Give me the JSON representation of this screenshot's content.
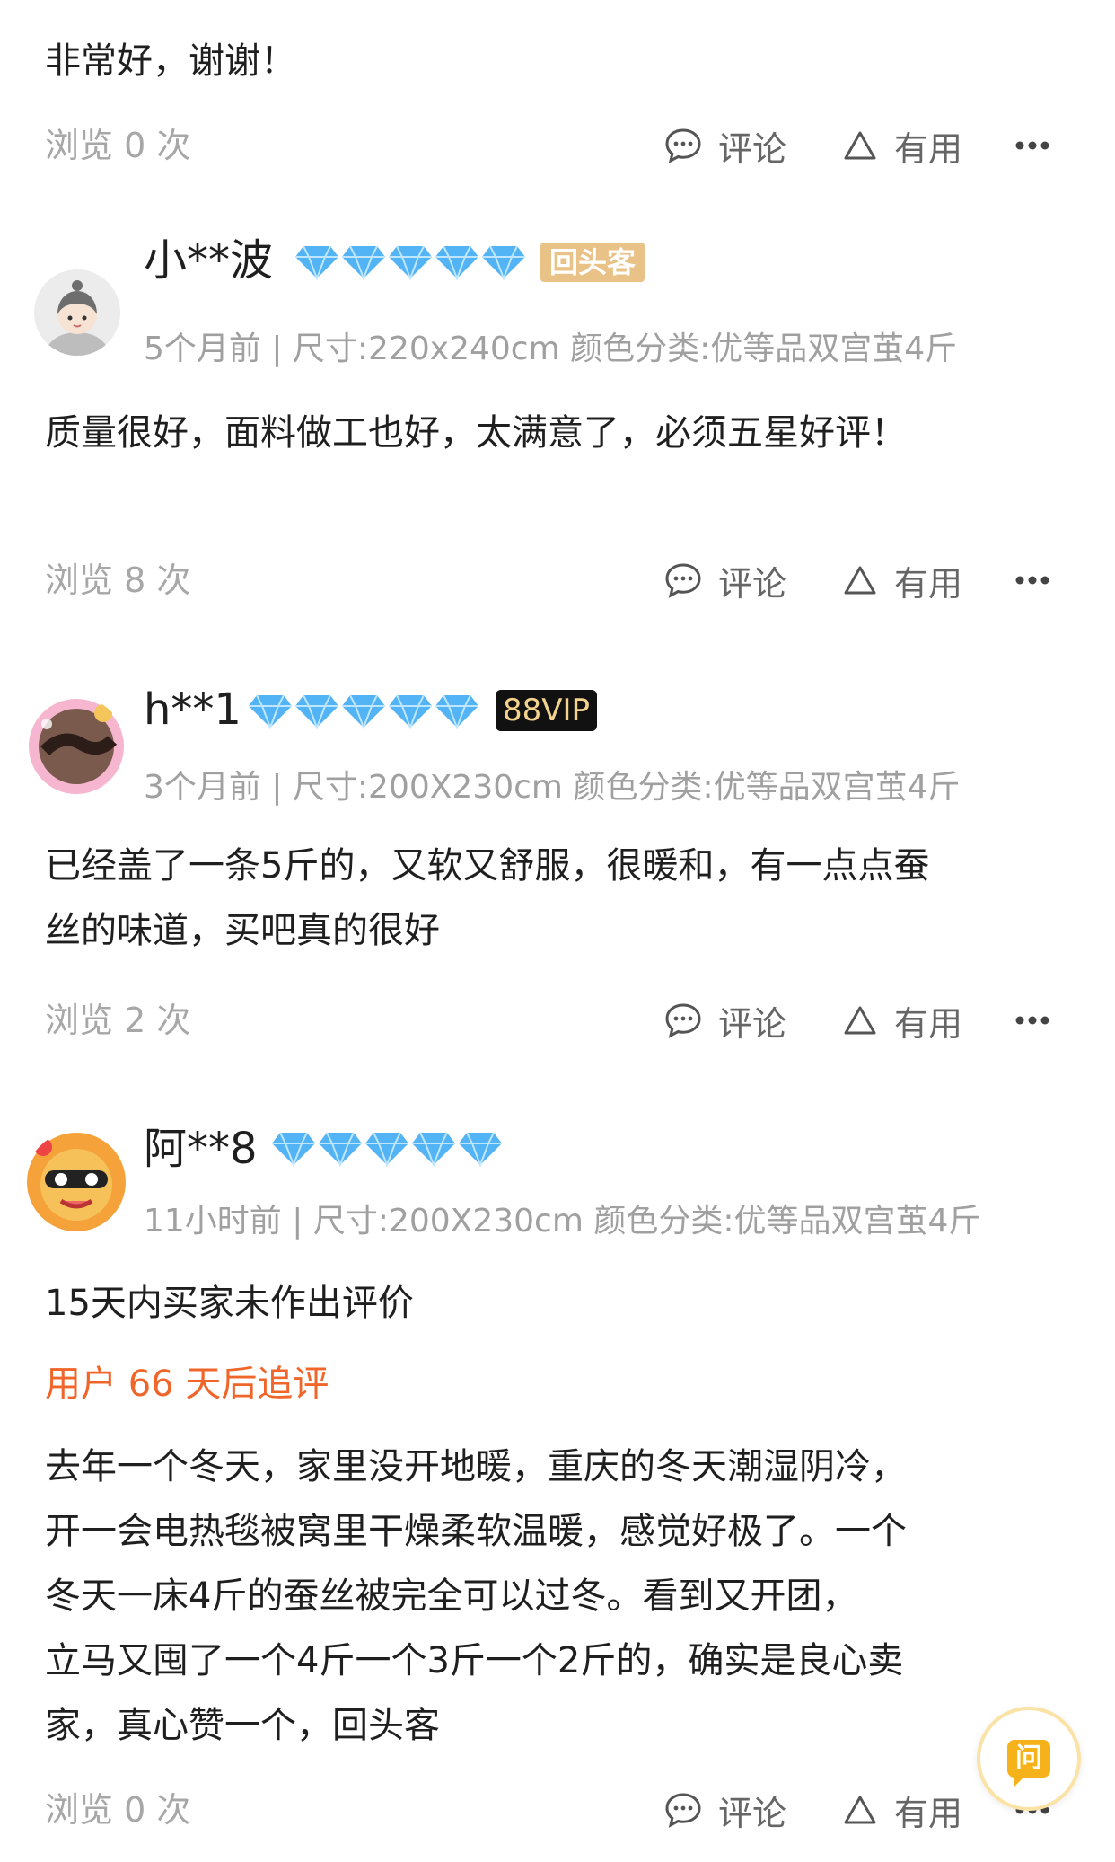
{
  "common": {
    "comment_label": "评论",
    "useful_label": "有用",
    "comment_icon": "comment-bubble-icon",
    "useful_icon": "triangle-thumb-icon",
    "more_icon": "more-dots-icon",
    "diamond_color": "#52b3f5",
    "accent_orange": "#f0652a"
  },
  "reviews": [
    {
      "text": "非常好，谢谢！",
      "views": "浏览 0 次"
    },
    {
      "username": "小**波",
      "diamonds": 5,
      "badge": "回头客",
      "meta": "5个月前 | 尺寸:220x240cm 颜色分类:优等品双宫茧4斤",
      "text": "质量很好，面料做工也好，太满意了，必须五星好评！",
      "views": "浏览 8 次"
    },
    {
      "username": "h**1",
      "diamonds": 5,
      "badge": "88VIP",
      "meta": "3个月前 | 尺寸:200X230cm 颜色分类:优等品双宫茧4斤",
      "text_lines": [
        "已经盖了一条5斤的，又软又舒服，很暖和，有一点点蚕",
        "丝的味道，买吧真的很好"
      ],
      "views": "浏览 2 次"
    },
    {
      "username": "阿**8",
      "diamonds": 5,
      "meta": "11小时前 | 尺寸:200X230cm 颜色分类:优等品双宫茧4斤",
      "text": "15天内买家未作出评价",
      "append_label": "用户 66 天后追评",
      "append_lines": [
        "去年一个冬天，家里没开地暖，重庆的冬天潮湿阴冷，",
        "开一会电热毯被窝里干燥柔软温暖，感觉好极了。一个",
        "冬天一床4斤的蚕丝被完全可以过冬。看到又开团，",
        "立马又囤了一个4斤一个3斤一个2斤的，确实是良心卖",
        "家，真心赞一个，回头客"
      ],
      "views": "浏览 0 次"
    }
  ],
  "ask_button": {
    "label": "问"
  }
}
